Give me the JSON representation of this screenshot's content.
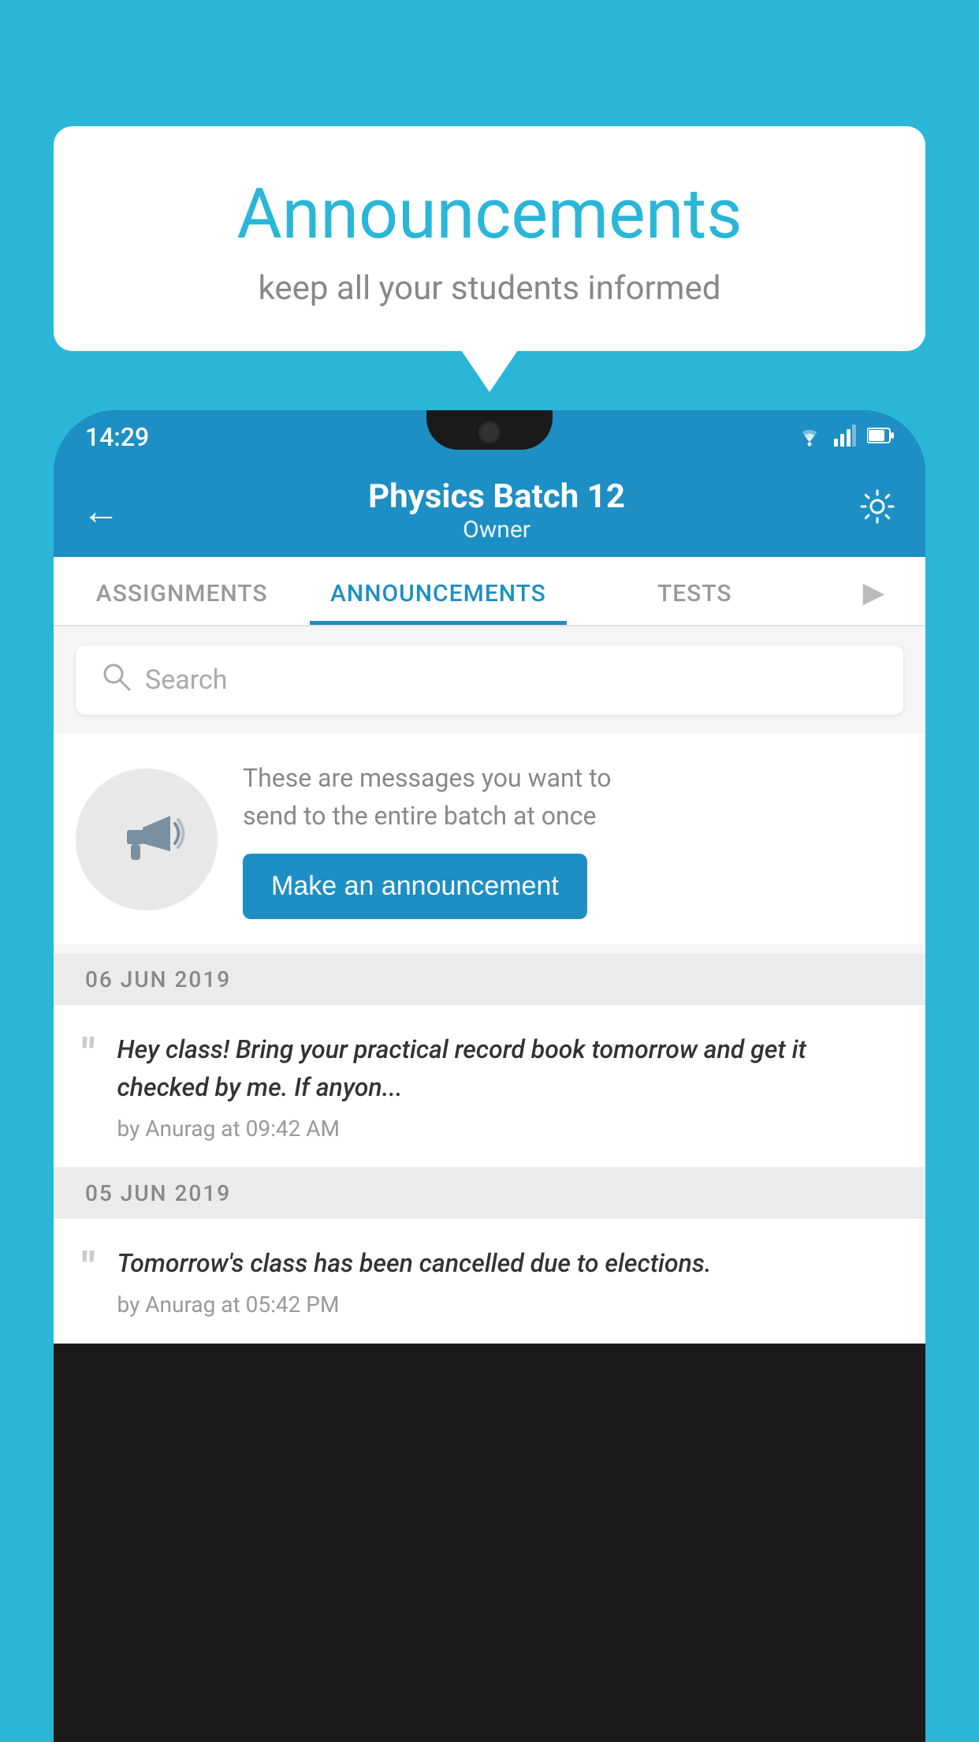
{
  "bubble": {
    "title": "Announcements",
    "subtitle": "keep all your students informed"
  },
  "status_bar": {
    "time": "14:29",
    "wifi": "▾",
    "signal": "▲",
    "battery": "▮"
  },
  "app_bar": {
    "title": "Physics Batch 12",
    "subtitle": "Owner",
    "back_label": "←",
    "settings_label": "⚙"
  },
  "tabs": [
    {
      "label": "ASSIGNMENTS",
      "active": false
    },
    {
      "label": "ANNOUNCEMENTS",
      "active": true
    },
    {
      "label": "TESTS",
      "active": false
    },
    {
      "label": "...",
      "active": false
    }
  ],
  "search": {
    "placeholder": "Search"
  },
  "announcement_card": {
    "description": "These are messages you want to\nsend to the entire batch at once",
    "button_label": "Make an announcement"
  },
  "messages": [
    {
      "date": "06  JUN  2019",
      "text": "Hey class! Bring your practical record book tomorrow and get it checked by me. If anyon...",
      "meta": "by Anurag at 09:42 AM"
    },
    {
      "date": "05  JUN  2019",
      "text": "Tomorrow's class has been cancelled due to elections.",
      "meta": "by Anurag at 05:42 PM"
    }
  ]
}
